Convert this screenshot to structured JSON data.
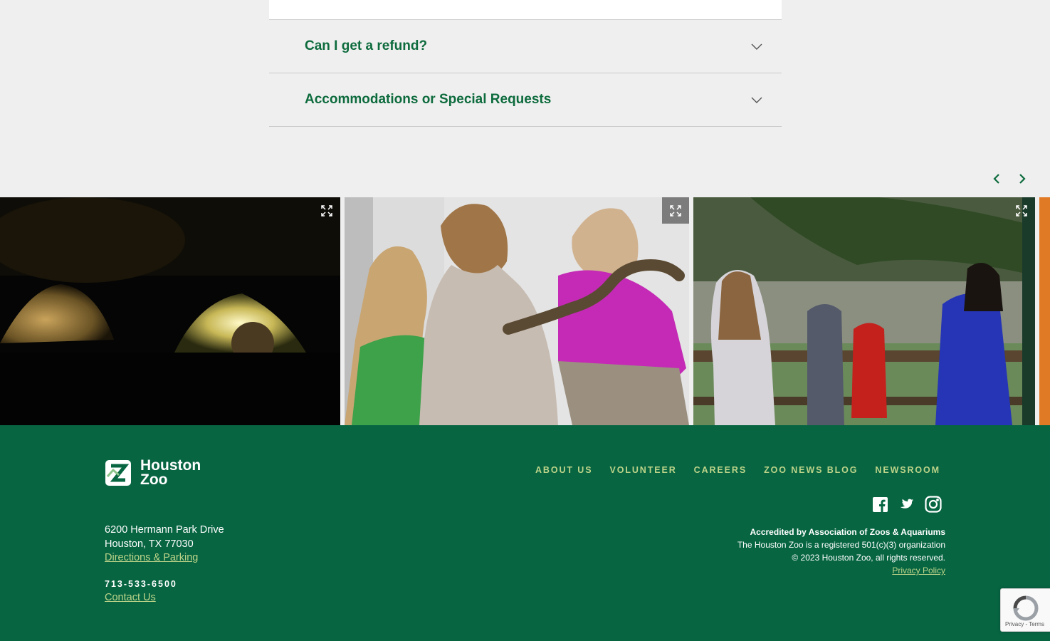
{
  "faq": {
    "items": [
      {
        "question": "Can I get a refund?"
      },
      {
        "question": "Accommodations or Special Requests"
      }
    ]
  },
  "gallery": {
    "prev_icon": "chevron-left-icon",
    "next_icon": "chevron-right-icon",
    "expand_icon": "expand-icon"
  },
  "footer": {
    "logo_line1": "Houston",
    "logo_line2": "Zoo",
    "address_line1": "6200 Hermann Park Drive",
    "address_line2": "Houston, TX 77030",
    "directions_link": "Directions & Parking",
    "phone": "713-533-6500",
    "contact_link": "Contact Us",
    "nav": [
      "ABOUT US",
      "VOLUNTEER",
      "CAREERS",
      "ZOO NEWS BLOG",
      "NEWSROOM"
    ],
    "social": [
      "facebook-icon",
      "twitter-icon",
      "instagram-icon"
    ],
    "accredited": "Accredited by Association of Zoos & Aquariums",
    "nonprofit": "The Houston Zoo is a registered 501(c)(3) organization",
    "copyright": "© 2023 Houston Zoo, all rights reserved.",
    "privacy_link": "Privacy Policy"
  },
  "recaptcha": {
    "text": "Privacy - Terms"
  },
  "colors": {
    "brand_green": "#076542",
    "heading_green": "#0d6b3d",
    "link_green": "#bed489",
    "background": "#efefef"
  }
}
